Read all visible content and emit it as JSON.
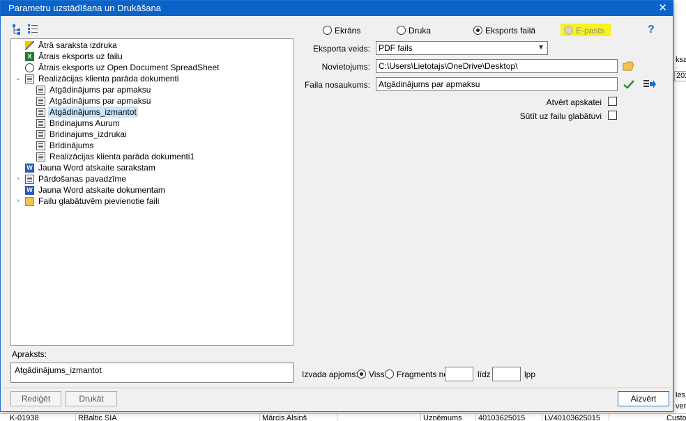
{
  "window": {
    "title": "Parametru uzstādīšana un Drukāšana",
    "close_symbol": "✕"
  },
  "toolbar": {
    "icons": [
      "tree-view-icon",
      "list-view-icon"
    ]
  },
  "tree": {
    "items": [
      {
        "label": "Ātrā saraksta izdruka",
        "icon": "wand-icon",
        "level": 0
      },
      {
        "label": "Ātrais eksports uz failu",
        "icon": "excel-icon",
        "level": 0
      },
      {
        "label": "Ātrais eksports uz Open Document SpreadSheet",
        "icon": "odt-icon",
        "level": 0
      },
      {
        "label": "Realizācijas klienta parāda dokumenti",
        "icon": "doc-icon",
        "level": 0,
        "expanded": true
      },
      {
        "label": "Atgādinājums par apmaksu",
        "icon": "doc-icon",
        "level": 1
      },
      {
        "label": "Atgādinājums par apmaksu",
        "icon": "doc-icon",
        "level": 1
      },
      {
        "label": "Atgādinājums_izmantot",
        "icon": "doc-icon",
        "level": 1,
        "selected": true
      },
      {
        "label": "Bridinajums Aurum",
        "icon": "doc-icon",
        "level": 1
      },
      {
        "label": "Bridinajums_izdrukai",
        "icon": "doc-icon",
        "level": 1
      },
      {
        "label": "Brīdinājums",
        "icon": "doc-icon",
        "level": 1
      },
      {
        "label": "Realizācijas klienta parāda dokumenti1",
        "icon": "doc-icon",
        "level": 1
      },
      {
        "label": "Jauna Word atskaite sarakstam",
        "icon": "word-icon",
        "level": 0
      },
      {
        "label": "Pārdošanas pavadzīme",
        "icon": "doc-icon",
        "level": 0,
        "collapsed": true
      },
      {
        "label": "Jauna Word atskaite dokumentam",
        "icon": "word-icon",
        "level": 0
      },
      {
        "label": "Failu glabātuvēm pievienotie faili",
        "icon": "folder-icon",
        "level": 0,
        "collapsed": true
      }
    ]
  },
  "output": {
    "options": [
      {
        "label": "Ekrāns",
        "selected": false
      },
      {
        "label": "Druka",
        "selected": false
      },
      {
        "label": "Eksports failā",
        "selected": true
      },
      {
        "label": "E-pasts",
        "selected": false,
        "disabled": true
      }
    ],
    "highlight_color": "#f7f221"
  },
  "export": {
    "type_label": "Eksporta veids:",
    "type_value": "PDF fails",
    "location_label": "Novietojums:",
    "location_value": "C:\\Users\\Lietotajs\\OneDrive\\Desktop\\",
    "filename_label": "Faila nosaukums:",
    "filename_value": "Atgādinājums par apmaksu",
    "open_label": "Atvērt apskatei",
    "send_label": "Sūtīt uz failu glabātuvi"
  },
  "description": {
    "label": "Apraksts:",
    "value": "Atgādinājums_izmantot"
  },
  "range": {
    "label": "Izvada apjoms:",
    "all_label": "Viss",
    "fragment_label": "Fragments no",
    "to_label": "līdz",
    "pages_label": "lpp",
    "from_value": "",
    "to_value": ""
  },
  "buttons": {
    "edit": "Rediģēt",
    "print": "Drukāt",
    "close": "Aizvērt"
  },
  "background": {
    "right_cells": [
      "ksas",
      "202",
      "les",
      "ver",
      "Custo"
    ],
    "bottom_cells": [
      "K-01938",
      "RBaltic SIA",
      "Mārcis Alsiņš",
      "Uzņēmums",
      "40103625015",
      "LV40103625015"
    ]
  },
  "colors": {
    "title_bar": "#0b62c9",
    "selection": "#cce4f7",
    "accent": "#1a6fcf"
  }
}
